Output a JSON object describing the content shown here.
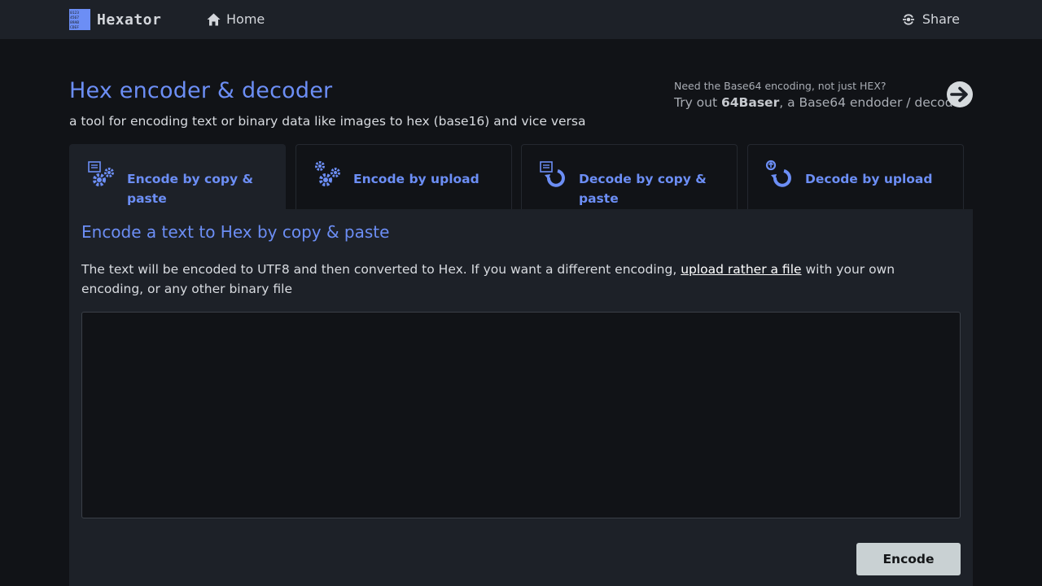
{
  "nav": {
    "brand": "Hexator",
    "home_label": "Home",
    "share_label": "Share"
  },
  "header": {
    "title": "Hex encoder & decoder",
    "subtitle": "a tool for encoding text or binary data like images to hex (base16) and vice versa"
  },
  "promo": {
    "question": "Need the Base64 encoding, not just HEX?",
    "line_prefix": "Try out ",
    "product": "64Baser",
    "line_suffix": ", a Base64 endoder / decoder"
  },
  "tabs": [
    {
      "label": "Encode by copy & paste",
      "icon": "encode-paste-icon",
      "active": true
    },
    {
      "label": "Encode by upload",
      "icon": "gears-icon",
      "active": false
    },
    {
      "label": "Decode by copy & paste",
      "icon": "decode-paste-icon",
      "active": false
    },
    {
      "label": "Decode by upload",
      "icon": "decode-upload-icon",
      "active": false
    }
  ],
  "panel": {
    "title": "Encode a text to Hex by copy & paste",
    "desc_before": "The text will be encoded to UTF8 and then converted to Hex. If you want a different encoding, ",
    "desc_link": "upload rather a file",
    "desc_after": " with your own encoding, or any other binary file",
    "input_value": "",
    "encode_label": "Encode"
  },
  "colors": {
    "accent": "#6c8ef5",
    "navbar_bg": "#1d2128",
    "page_bg": "#111317",
    "button_bg": "#c9d1d3"
  }
}
